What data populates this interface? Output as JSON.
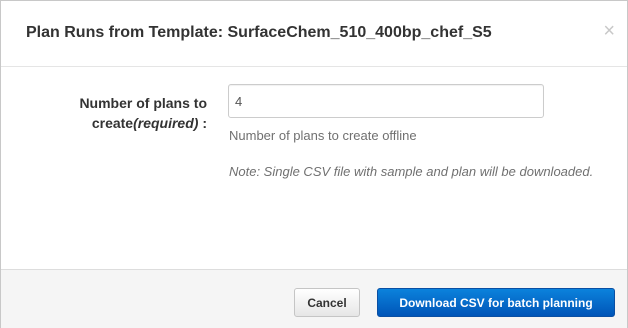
{
  "dialog": {
    "title": "Plan Runs from Template: SurfaceChem_510_400bp_chef_S5",
    "close_glyph": "×"
  },
  "form": {
    "label_main": "Number of plans to create",
    "label_required": "(required)",
    "label_suffix": " :",
    "plans_value": "4",
    "help": "Number of plans to create offline",
    "note": "Note: Single CSV file with sample and plan will be downloaded."
  },
  "footer": {
    "cancel_label": "Cancel",
    "download_label": "Download CSV for batch planning"
  },
  "colors": {
    "primary": "#0066cc",
    "footer_bg": "#f5f5f5"
  }
}
